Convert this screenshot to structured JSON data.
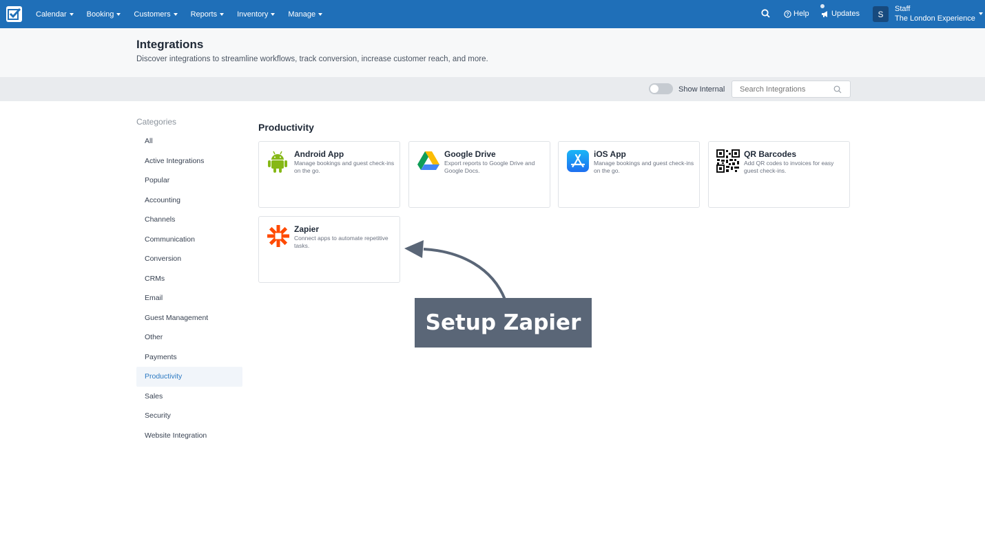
{
  "nav": {
    "menu": [
      {
        "label": "Calendar"
      },
      {
        "label": "Booking"
      },
      {
        "label": "Customers"
      },
      {
        "label": "Reports"
      },
      {
        "label": "Inventory"
      },
      {
        "label": "Manage"
      }
    ],
    "help_label": "Help",
    "updates_label": "Updates",
    "avatar_initial": "S",
    "user_role": "Staff",
    "user_company": "The London Experience",
    "brand_color": "#1f6fb8"
  },
  "header": {
    "title": "Integrations",
    "subtitle": "Discover integrations to streamline workflows, track conversion, increase customer reach, and more."
  },
  "filters": {
    "show_internal_label": "Show Internal",
    "show_internal_on": false,
    "search_placeholder": "Search Integrations"
  },
  "sidebar": {
    "title": "Categories",
    "items": [
      {
        "label": "All"
      },
      {
        "label": "Active Integrations"
      },
      {
        "label": "Popular"
      },
      {
        "label": "Accounting"
      },
      {
        "label": "Channels"
      },
      {
        "label": "Communication"
      },
      {
        "label": "Conversion"
      },
      {
        "label": "CRMs"
      },
      {
        "label": "Email"
      },
      {
        "label": "Guest Management"
      },
      {
        "label": "Other"
      },
      {
        "label": "Payments"
      },
      {
        "label": "Productivity"
      },
      {
        "label": "Sales"
      },
      {
        "label": "Security"
      },
      {
        "label": "Website Integration"
      }
    ],
    "active": "Productivity"
  },
  "main": {
    "section_title": "Productivity",
    "cards": [
      {
        "name": "Android App",
        "desc": "Manage bookings and guest check-ins on the go.",
        "icon": "android-icon"
      },
      {
        "name": "Google Drive",
        "desc": "Export reports to Google Drive and Google Docs.",
        "icon": "google-drive-icon"
      },
      {
        "name": "iOS App",
        "desc": "Manage bookings and guest check-ins on the go.",
        "icon": "app-store-icon"
      },
      {
        "name": "QR Barcodes",
        "desc": "Add QR codes to invoices for easy guest check-ins.",
        "icon": "qr-code-icon"
      },
      {
        "name": "Zapier",
        "desc": "Connect apps to automate repetitive tasks.",
        "icon": "zapier-icon"
      }
    ]
  },
  "annotation": {
    "callout_text": "Setup Zapier"
  }
}
